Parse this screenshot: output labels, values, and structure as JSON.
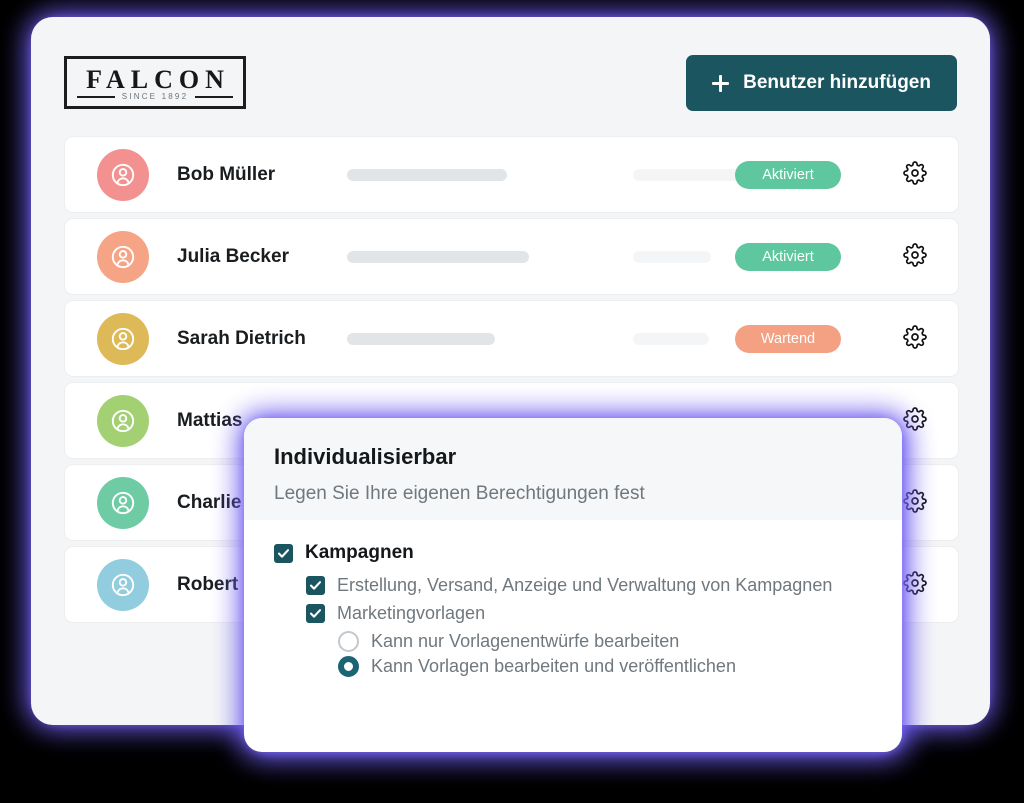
{
  "brand": {
    "logo_word": "FALCON",
    "logo_sub": "SINCE 1892"
  },
  "header": {
    "add_user_label": "Benutzer hinzufügen",
    "add_icon": "plus-icon"
  },
  "colors": {
    "accent_teal": "#1b5560",
    "badge_active": "#5fc79f",
    "badge_pending": "#f4a183",
    "glow": "#6f5df0",
    "card_bg": "#f4f5f6",
    "radio_on": "#1b6473"
  },
  "users": [
    {
      "name": "Bob Müller",
      "avatar_color": "#f39191",
      "avatar_icon": "person-circle-icon",
      "status": "Aktiviert",
      "status_kind": "active",
      "skeleton_a_width": 160,
      "skeleton_b_width": 130,
      "settings_icon": "gear-icon"
    },
    {
      "name": "Julia Becker",
      "avatar_color": "#f6a486",
      "avatar_icon": "person-circle-icon",
      "status": "Aktiviert",
      "status_kind": "active",
      "skeleton_a_width": 182,
      "skeleton_b_width": 78,
      "settings_icon": "gear-icon"
    },
    {
      "name": "Sarah Dietrich",
      "avatar_color": "#ddb košt",
      "avatar_icon": "person-circle-icon",
      "status": "Wartend",
      "status_kind": "pending",
      "skeleton_a_width": 148,
      "skeleton_b_width": 76,
      "settings_icon": "gear-icon"
    },
    {
      "name": "Mattias",
      "avatar_color": "#a3d073",
      "avatar_icon": "person-circle-icon",
      "status": "",
      "status_kind": "none",
      "skeleton_a_width": 0,
      "skeleton_b_width": 0,
      "settings_icon": "gear-icon"
    },
    {
      "name": "Charlie",
      "avatar_color": "#6ecba4",
      "avatar_icon": "person-circle-icon",
      "status": "",
      "status_kind": "none",
      "skeleton_a_width": 0,
      "skeleton_b_width": 0,
      "settings_icon": "gear-icon"
    },
    {
      "name": "Robert",
      "avatar_color": "#92ccdf",
      "avatar_icon": "person-circle-icon",
      "status": "",
      "status_kind": "none",
      "skeleton_a_width": 0,
      "skeleton_b_width": 0,
      "settings_icon": "gear-icon"
    }
  ],
  "modal": {
    "title": "Individualisierbar",
    "subtitle": "Legen Sie Ihre eigenen Berechtigungen fest",
    "permissions": {
      "group_label": "Kampagnen",
      "group_checked": true,
      "items": [
        {
          "label": "Erstellung, Versand, Anzeige und Verwaltung von Kampagnen",
          "checked": true
        },
        {
          "label": "Marketingvorlagen",
          "checked": true
        }
      ],
      "radio_options": [
        {
          "label": "Kann nur Vorlagenentwürfe bearbeiten",
          "selected": false
        },
        {
          "label": "Kann Vorlagen bearbeiten und veröffentlichen",
          "selected": true
        }
      ]
    }
  }
}
